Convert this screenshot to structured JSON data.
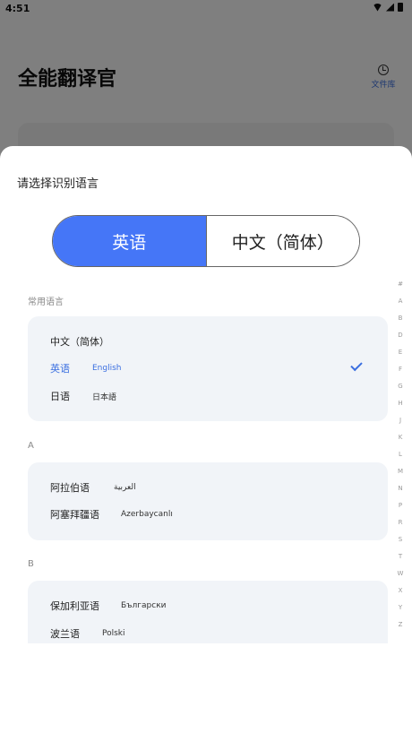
{
  "status_bar": {
    "time": "4:51"
  },
  "app": {
    "title": "全能翻译官",
    "library_label": "文件库"
  },
  "sheet": {
    "title": "请选择识别语言",
    "toggle": {
      "left": "英语",
      "right": "中文（简体）",
      "active": "left"
    },
    "sections": [
      {
        "header": "常用语言",
        "items": [
          {
            "name": "中文（简体）",
            "native": ""
          },
          {
            "name": "英语",
            "native": "English",
            "selected": true
          },
          {
            "name": "日语",
            "native": "日本語"
          }
        ]
      },
      {
        "header": "A",
        "items": [
          {
            "name": "阿拉伯语",
            "native": "العربية"
          },
          {
            "name": "阿塞拜疆语",
            "native": "Azerbaycanlı"
          }
        ]
      },
      {
        "header": "B",
        "items": [
          {
            "name": "保加利亚语",
            "native": "Български"
          },
          {
            "name": "波兰语",
            "native": "Polski"
          }
        ]
      }
    ],
    "alpha_index": [
      "#",
      "A",
      "B",
      "D",
      "E",
      "F",
      "G",
      "H",
      "J",
      "K",
      "L",
      "M",
      "N",
      "P",
      "R",
      "S",
      "T",
      "W",
      "X",
      "Y",
      "Z"
    ]
  },
  "colors": {
    "accent": "#4576f7",
    "card": "#f1f4f8"
  }
}
